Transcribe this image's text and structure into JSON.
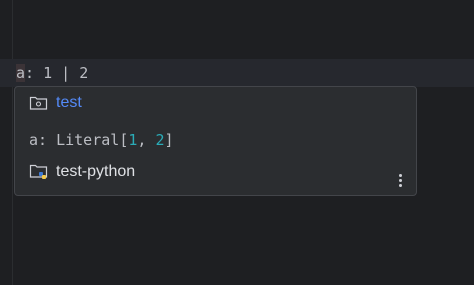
{
  "editor": {
    "code": {
      "caret_char": "a",
      "rest": ": 1 | 2"
    }
  },
  "popup": {
    "module_link": "test",
    "module_icon": "python-module-folder-icon",
    "signature": {
      "name": "a",
      "colon": ": ",
      "type": "Literal",
      "open": "[",
      "val1": "1",
      "sep": ", ",
      "val2": "2",
      "close": "]"
    },
    "project_name": "test-python",
    "project_icon": "python-project-folder-icon",
    "more_icon": "more-vertical-icon"
  },
  "colors": {
    "background": "#1e1f22",
    "popup_bg": "#2b2d30",
    "link": "#548af7",
    "number": "#2aacb8",
    "text": "#bcbec4"
  }
}
